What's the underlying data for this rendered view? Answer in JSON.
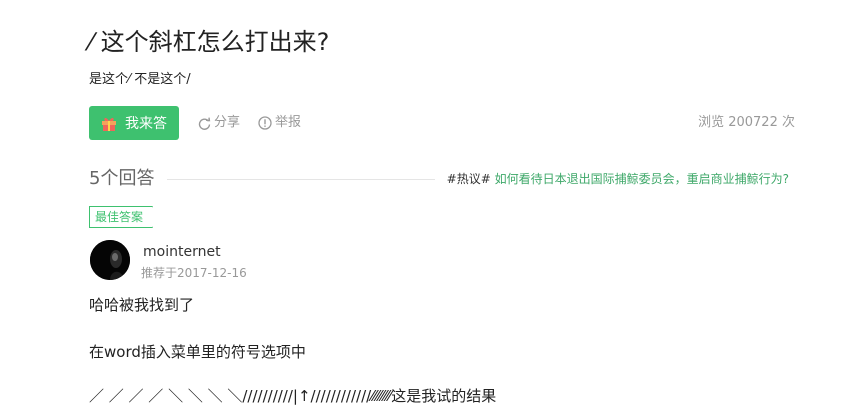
{
  "question": {
    "title": "⁄ 这个斜杠怎么打出来?",
    "description": "是这个⁄ 不是这个/"
  },
  "actions": {
    "answer_label": "我来答",
    "share_label": "分享",
    "report_label": "举报",
    "views_text": "浏览 200722 次"
  },
  "answers_header": {
    "count_label": "5个回答",
    "hot_tag": "#热议#",
    "hot_link": "如何看待日本退出国际捕鲸委员会，重启商业捕鲸行为?"
  },
  "best_answer": {
    "badge": "最佳答案",
    "author": "mointernet",
    "recommended_date": "推荐于2017-12-16",
    "lines": [
      "哈哈被我找到了",
      "在word插入菜单里的符号选项中",
      "／ ／ ／ ／ ＼ ＼ ＼ ＼//////////|↑////////////⁄⁄⁄⁄⁄⁄⁄⁄这是我试的结果"
    ]
  },
  "colors": {
    "accent": "#3ec16f",
    "link": "#3ea869",
    "muted": "#999999"
  },
  "icons": {
    "answer": "gift-icon",
    "share": "share-icon",
    "report": "report-icon"
  }
}
